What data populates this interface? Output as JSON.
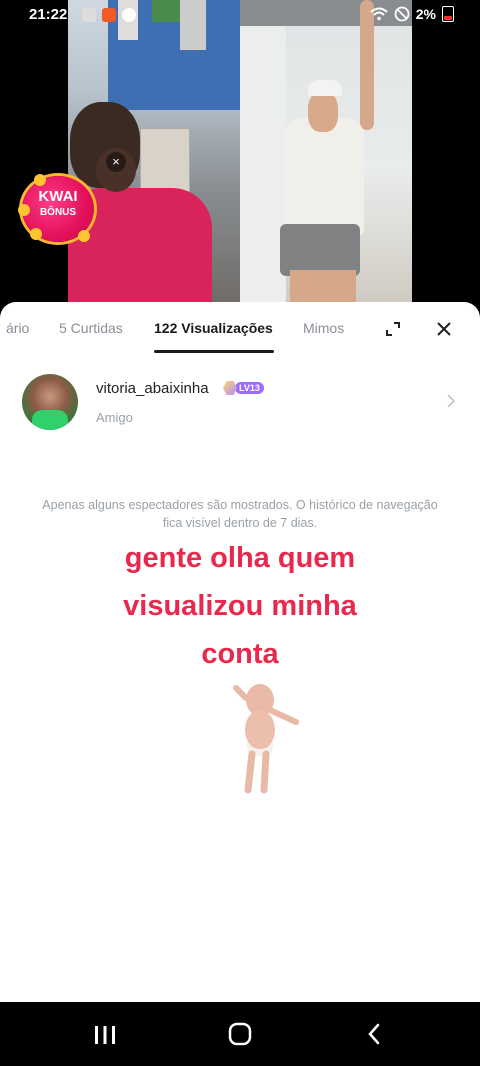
{
  "status_bar": {
    "time": "21:22",
    "battery": "2%"
  },
  "kwai_badge": {
    "line1": "KWAI",
    "line2": "BÔNUS",
    "close": "×"
  },
  "tabs": [
    {
      "label": "ário"
    },
    {
      "label": "5 Curtidas"
    },
    {
      "label": "122 Visualizações",
      "active": true
    },
    {
      "label": "Mimos"
    }
  ],
  "viewer": {
    "username": "vitoria_abaixinha",
    "level": "LV13",
    "relation": "Amigo"
  },
  "notice": {
    "line1": "Apenas alguns espectadores são mostrados. O histórico de navegação",
    "line2": "fica visível dentro de 7 dias."
  },
  "meme_text": {
    "line1": "gente olha quem",
    "line2": "visualizou minha",
    "line3": "conta"
  },
  "colors": {
    "accent_red": "#e8294d",
    "level_purple": "#9b6cff",
    "kwai_pink": "#e3105a"
  }
}
